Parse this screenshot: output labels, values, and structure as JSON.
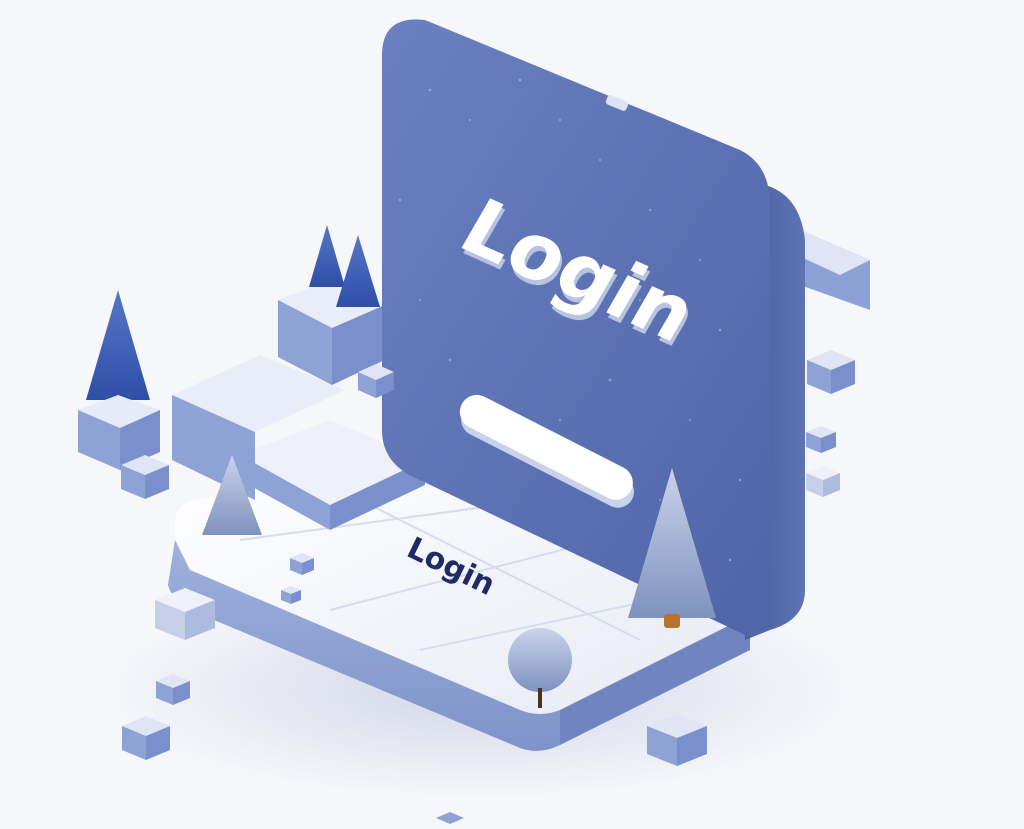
{
  "scene": {
    "description_free": true,
    "panel_title": "Login",
    "floor_label": "Login",
    "colors": {
      "background": "#f6f7fb",
      "panel_blue": "#5b72b3",
      "panel_blue_dark": "#4a5f9e",
      "platform_white": "#f3f5fb",
      "platform_side": "#8ea0d2",
      "cube_blue": "#7d93cf",
      "tree_blue": "#3d5fb5",
      "text_navy": "#1f2a66"
    },
    "icons": [
      "pine-tree-icon",
      "round-tree-icon",
      "cube-icon"
    ]
  }
}
